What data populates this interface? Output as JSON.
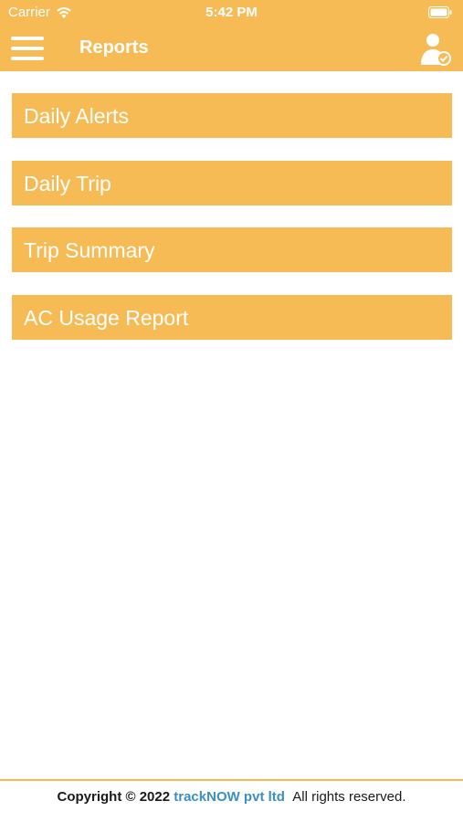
{
  "status_bar": {
    "carrier": "Carrier",
    "time": "5:42 PM",
    "icons": [
      "wifi-icon",
      "battery-icon"
    ]
  },
  "nav": {
    "title": "Reports",
    "menu_icon": "hamburger-menu-icon",
    "profile_icon": "user-verified-icon"
  },
  "reports": [
    {
      "label": "Daily Alerts"
    },
    {
      "label": "Daily Trip"
    },
    {
      "label": "Trip Summary"
    },
    {
      "label": "AC Usage Report"
    }
  ],
  "footer": {
    "copyright": "Copyright © 2022",
    "brand": "trackNOW pvt ltd",
    "rights": "All rights reserved."
  },
  "colors": {
    "accent": "#f7bb55",
    "brand_link": "#3a8fc4",
    "background": "#ffffff"
  }
}
